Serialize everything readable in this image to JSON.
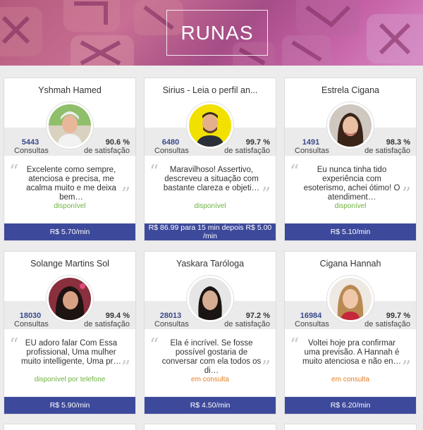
{
  "banner": {
    "title": "RUNAS"
  },
  "colors": {
    "price_bar": "#3d4a9b",
    "available": "#6cb33f",
    "busy": "#e67e22",
    "accent_count": "#3a4a8c"
  },
  "labels": {
    "consultas": "Consultas",
    "satisfacao": "de satisfação"
  },
  "cards": [
    {
      "name": "Yshmah Hamed",
      "count": "5443",
      "pct": "90.6 %",
      "review": "Excelente como sempre, atenciosa e precisa, me acalma muito e me deixa bem…",
      "status": "disponível",
      "status_type": "available",
      "price": "R$ 5.70/min",
      "photo": "photo-1"
    },
    {
      "name": "Sirius - Leia o perfil an...",
      "count": "6480",
      "pct": "99.7 %",
      "review": "Maravilhoso! Assertivo, descreveu a situação com bastante clareza e objeti…",
      "status": "disponível",
      "status_type": "available",
      "price": "R$ 86.99 para 15 min depois R$ 5.00 /min",
      "photo": "photo-2"
    },
    {
      "name": "Estrela Cigana",
      "count": "1491",
      "pct": "98.3 %",
      "review": "Eu nunca tinha tido experiência com esoterismo, achei ótimo! O atendiment…",
      "status": "disponível",
      "status_type": "available",
      "price": "R$ 5.10/min",
      "photo": "photo-3"
    },
    {
      "name": "Solange Martins Sol",
      "count": "18030",
      "pct": "99.4 %",
      "review": "EU adoro falar Com Essa profissional, Uma mulher muito intelligente, Uma pr…",
      "status": "disponível por telefone",
      "status_type": "available",
      "price": "R$ 5.90/min",
      "photo": "photo-4"
    },
    {
      "name": "Yaskara Taróloga",
      "count": "28013",
      "pct": "97.2 %",
      "review": "Ela é incrível. Se fosse possível gostaria de conversar com ela todos os di…",
      "status": "em consulta",
      "status_type": "busy",
      "price": "R$ 4.50/min",
      "photo": "photo-5"
    },
    {
      "name": "Cigana Hannah",
      "count": "16984",
      "pct": "99.7 %",
      "review": "Voltei hoje pra confirmar uma previsão. A Hannah é muito atenciosa e não en…",
      "status": "em consulta",
      "status_type": "busy",
      "price": "R$ 6.20/min",
      "photo": "photo-6"
    }
  ]
}
